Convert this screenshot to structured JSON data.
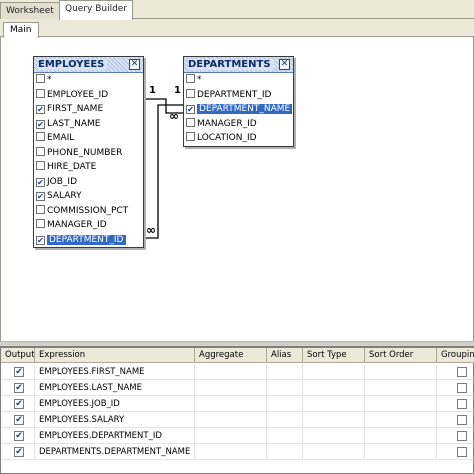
{
  "tabs": {
    "worksheet": "Worksheet",
    "query_builder": "Query Builder"
  },
  "inner_tabs": {
    "main": "Main"
  },
  "employees_table": {
    "title": "EMPLOYEES",
    "columns": [
      {
        "name": "*",
        "checked": false,
        "selected": false
      },
      {
        "name": "EMPLOYEE_ID",
        "checked": false,
        "selected": false
      },
      {
        "name": "FIRST_NAME",
        "checked": true,
        "selected": false
      },
      {
        "name": "LAST_NAME",
        "checked": true,
        "selected": false
      },
      {
        "name": "EMAIL",
        "checked": false,
        "selected": false
      },
      {
        "name": "PHONE_NUMBER",
        "checked": false,
        "selected": false
      },
      {
        "name": "HIRE_DATE",
        "checked": false,
        "selected": false
      },
      {
        "name": "JOB_ID",
        "checked": true,
        "selected": false
      },
      {
        "name": "SALARY",
        "checked": true,
        "selected": false
      },
      {
        "name": "COMMISSION_PCT",
        "checked": false,
        "selected": false
      },
      {
        "name": "MANAGER_ID",
        "checked": false,
        "selected": false
      },
      {
        "name": "DEPARTMENT_ID",
        "checked": true,
        "selected": true
      }
    ]
  },
  "departments_table": {
    "title": "DEPARTMENTS",
    "columns": [
      {
        "name": "*",
        "checked": false,
        "selected": false
      },
      {
        "name": "DEPARTMENT_ID",
        "checked": false,
        "selected": false
      },
      {
        "name": "DEPARTMENT_NAME",
        "checked": true,
        "selected": true
      },
      {
        "name": "MANAGER_ID",
        "checked": false,
        "selected": false
      },
      {
        "name": "LOCATION_ID",
        "checked": false,
        "selected": false
      }
    ]
  },
  "links": {
    "one_label_left": "1",
    "one_label_right": "1",
    "many_label_upper": "∞",
    "many_label_lower": "∞"
  },
  "grid": {
    "headers": {
      "output": "Output",
      "expression": "Expression",
      "aggregate": "Aggregate",
      "alias": "Alias",
      "sort_type": "Sort Type",
      "sort_order": "Sort Order",
      "grouping": "Grouping"
    },
    "rows": [
      {
        "output": true,
        "expression": "EMPLOYEES.FIRST_NAME",
        "grouping": false
      },
      {
        "output": true,
        "expression": "EMPLOYEES.LAST_NAME",
        "grouping": false
      },
      {
        "output": true,
        "expression": "EMPLOYEES.JOB_ID",
        "grouping": false
      },
      {
        "output": true,
        "expression": "EMPLOYEES.SALARY",
        "grouping": false
      },
      {
        "output": true,
        "expression": "EMPLOYEES.DEPARTMENT_ID",
        "grouping": false
      },
      {
        "output": true,
        "expression": "DEPARTMENTS.DEPARTMENT_NAME",
        "grouping": false
      }
    ]
  },
  "colors": {
    "selection": "#316ac5",
    "header_text": "#0b2a66",
    "link_line": "#000000"
  }
}
